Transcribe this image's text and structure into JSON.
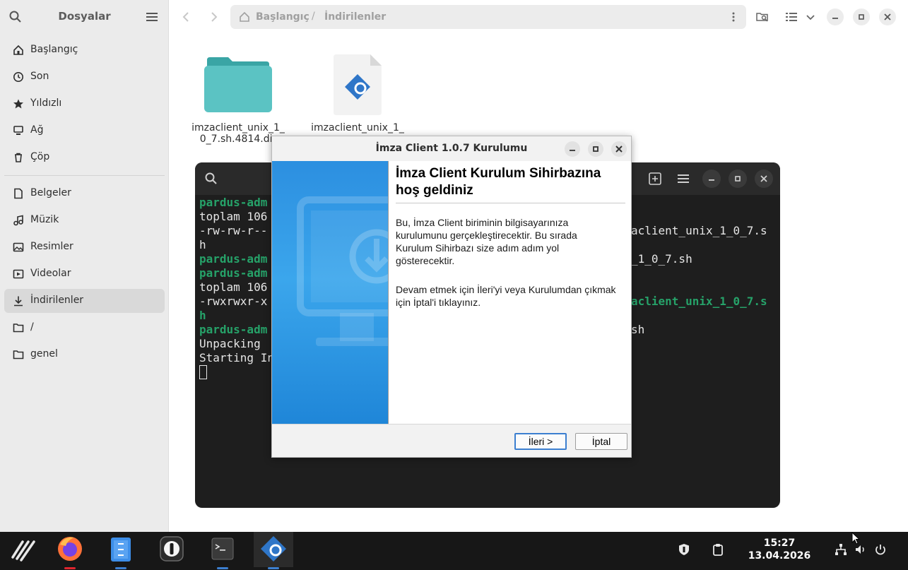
{
  "file_manager": {
    "title": "Dosyalar",
    "sidebar": {
      "places": [
        {
          "label": "Başlangıç",
          "icon": "home-icon"
        },
        {
          "label": "Son",
          "icon": "clock-icon"
        },
        {
          "label": "Yıldızlı",
          "icon": "star-icon"
        },
        {
          "label": "Ağ",
          "icon": "network-icon"
        },
        {
          "label": "Çöp",
          "icon": "trash-icon"
        }
      ],
      "folders": [
        {
          "label": "Belgeler",
          "icon": "document-icon"
        },
        {
          "label": "Müzik",
          "icon": "music-icon"
        },
        {
          "label": "Resimler",
          "icon": "image-icon"
        },
        {
          "label": "Videolar",
          "icon": "video-icon"
        },
        {
          "label": "İndirilenler",
          "icon": "download-icon",
          "active": true
        },
        {
          "label": "/",
          "icon": "folder-icon"
        },
        {
          "label": "genel",
          "icon": "folder-icon"
        }
      ]
    },
    "path": {
      "home": "Başlangıç",
      "separator": "/",
      "current": "İndirilenler"
    },
    "files": [
      {
        "name_line1": "imzaclient_unix_1_",
        "name_line2": "0_7.sh.4814.dir",
        "type": "folder"
      },
      {
        "name_line1": "imzaclient_unix_1_",
        "type": "installer"
      }
    ]
  },
  "terminal": {
    "lines": [
      {
        "text": "pardus-adm",
        "prompt": true,
        "right": ""
      },
      {
        "text": "toplam 106",
        "prompt": false,
        "right": ""
      },
      {
        "text": "-rw-rw-r--",
        "prompt": false,
        "right": "aclient_unix_1_0_7.s"
      },
      {
        "text": "h",
        "prompt": false,
        "right": ""
      },
      {
        "text": "pardus-adm",
        "prompt": true,
        "right": "_1_0_7.sh"
      },
      {
        "text": "pardus-adm",
        "prompt": true,
        "right": ""
      },
      {
        "text": "toplam 106",
        "prompt": false,
        "right": ""
      },
      {
        "text": "-rwxrwxr-x",
        "prompt": false,
        "right": "aclient_unix_1_0_7.s"
      },
      {
        "text": "h",
        "prompt": true,
        "right": ""
      },
      {
        "text": "pardus-adm",
        "prompt": true,
        "right": "sh"
      },
      {
        "text": "Unpacking ",
        "prompt": false,
        "right": ""
      },
      {
        "text": "Starting In",
        "prompt": false,
        "right": ""
      }
    ]
  },
  "dialog": {
    "title": "İmza Client 1.0.7 Kurulumu",
    "heading_line1": "İmza Client Kurulum Sihirbazına",
    "heading_line2": "hoş geldiniz",
    "para1_lines": [
      "Bu, İmza Client biriminin bilgisayarınıza",
      "kurulumunu gerçekleştirecektir. Bu sırada",
      "Kurulum Sihirbazı size adım adım yol",
      "gösterecektir."
    ],
    "para2_lines": [
      "Devam etmek için İleri'yi veya Kurulumdan çıkmak",
      "için İptal'i tıklayınız."
    ],
    "next_label": "İleri >",
    "cancel_label": "İptal"
  },
  "taskbar": {
    "time": "15:27",
    "date": "13.04.2026",
    "apps": [
      "pardus-menu-icon",
      "firefox-icon",
      "files-icon",
      "password-manager-icon",
      "terminal-icon",
      "installer-icon"
    ],
    "accent": "#3c7fd0"
  }
}
